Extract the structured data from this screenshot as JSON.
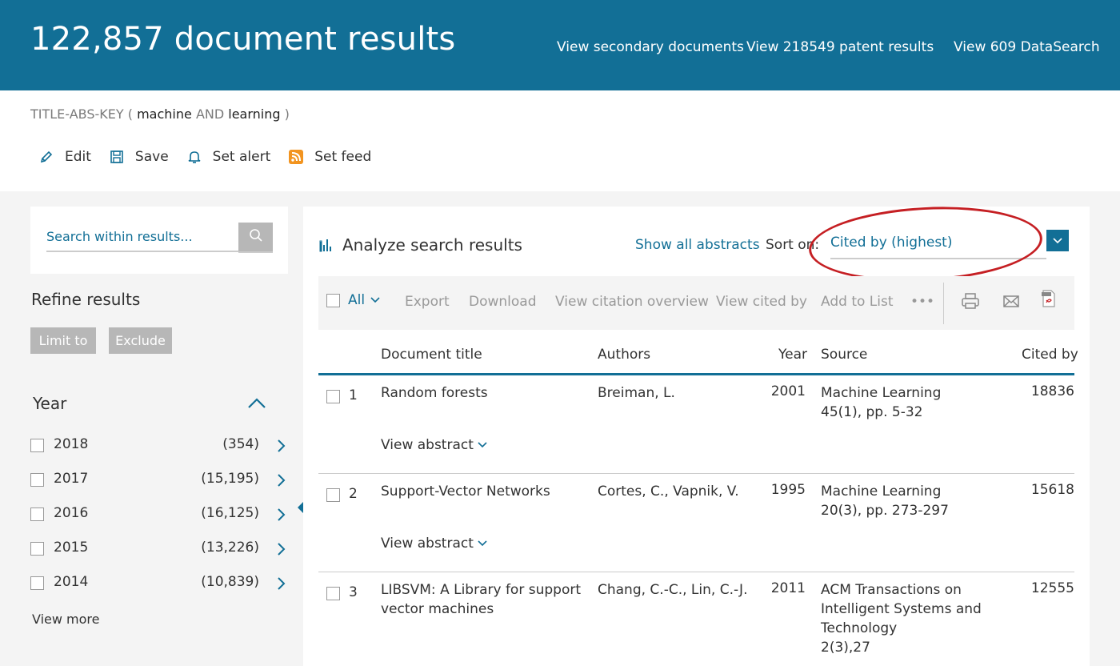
{
  "header": {
    "title": "122,857 document results",
    "links": [
      "View secondary documents",
      "View 218549 patent results",
      "View 609 DataSearch"
    ]
  },
  "query": {
    "prefix": "TITLE-ABS-KEY (",
    "term1": "machine",
    "op": "AND",
    "term2": "learning",
    "suffix": ")"
  },
  "query_actions": {
    "edit": "Edit",
    "save": "Save",
    "alert": "Set alert",
    "feed": "Set feed"
  },
  "sidebar": {
    "search_placeholder": "Search within results...",
    "refine": "Refine results",
    "limit_to": "Limit to",
    "exclude": "Exclude",
    "year_heading": "Year",
    "years": [
      {
        "year": "2018",
        "count": "(354)"
      },
      {
        "year": "2017",
        "count": "(15,195)"
      },
      {
        "year": "2016",
        "count": "(16,125)"
      },
      {
        "year": "2015",
        "count": "(13,226)"
      },
      {
        "year": "2014",
        "count": "(10,839)"
      }
    ],
    "view_more": "View more"
  },
  "main": {
    "analyze": "Analyze search results",
    "show_abstracts": "Show all abstracts",
    "sort_label": "Sort on:",
    "sort_value": "Cited by (highest)",
    "toolbar": {
      "all": "All",
      "export": "Export",
      "download": "Download",
      "citation": "View citation overview",
      "cited_by": "View cited by",
      "add_list": "Add to List",
      "more": "•••"
    },
    "columns": {
      "title": "Document title",
      "authors": "Authors",
      "year": "Year",
      "source": "Source",
      "cited": "Cited by"
    },
    "rows": [
      {
        "num": "1",
        "title": "Random forests",
        "authors": "Breiman, L.",
        "year": "2001",
        "source": "Machine Learning",
        "source_detail": "45(1), pp. 5-32",
        "cited": "18836",
        "abstract": "View abstract"
      },
      {
        "num": "2",
        "title": "Support-Vector Networks",
        "authors": "Cortes, C., Vapnik, V.",
        "year": "1995",
        "source": "Machine Learning",
        "source_detail": "20(3), pp. 273-297",
        "cited": "15618",
        "abstract": "View abstract"
      },
      {
        "num": "3",
        "title": "LIBSVM: A Library for support vector machines",
        "authors": "Chang, C.-C., Lin, C.-J.",
        "year": "2011",
        "source": "ACM Transactions on Intelligent Systems and Technology",
        "source_detail": "2(3),27",
        "cited": "12555"
      }
    ]
  },
  "colors": {
    "brand": "#126f96",
    "highlight": "#c51f23"
  }
}
